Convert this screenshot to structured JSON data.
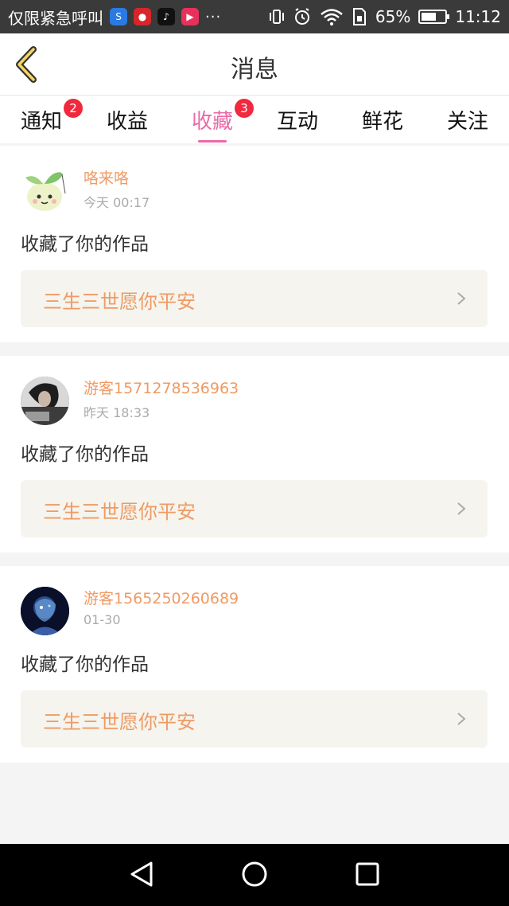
{
  "status_bar": {
    "carrier": "仅限紧急呼叫",
    "more": "···",
    "battery_percent": "65%",
    "battery_level": 0.65,
    "time": "11:12"
  },
  "header": {
    "title": "消息"
  },
  "tabs": [
    {
      "label": "通知",
      "badge": "2"
    },
    {
      "label": "收益",
      "badge": ""
    },
    {
      "label": "收藏",
      "badge": "3",
      "active": true
    },
    {
      "label": "互动",
      "badge": ""
    },
    {
      "label": "鲜花",
      "badge": ""
    },
    {
      "label": "关注",
      "badge": ""
    }
  ],
  "messages": [
    {
      "user": "咯来咯",
      "time": "今天 00:17",
      "action": "收藏了你的作品",
      "work": "三生三世愿你平安"
    },
    {
      "user": "游客1571278536963",
      "time": "昨天 18:33",
      "action": "收藏了你的作品",
      "work": "三生三世愿你平安"
    },
    {
      "user": "游客1565250260689",
      "time": "01-30",
      "action": "收藏了你的作品",
      "work": "三生三世愿你平安"
    }
  ],
  "colors": {
    "accent": "#e96aa6",
    "username": "#f09a63",
    "badge": "#f0293f"
  }
}
